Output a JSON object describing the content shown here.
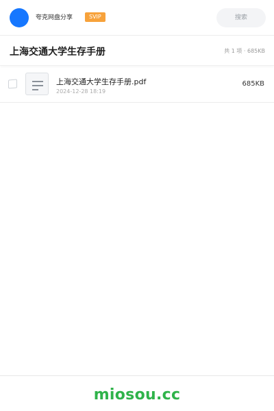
{
  "header": {
    "app_name": "夸克网盘分享",
    "badge": "SVIP",
    "search_label": "搜索"
  },
  "share": {
    "title": "上海交通大学生存手册",
    "summary": "共 1 项 · 685KB"
  },
  "files": [
    {
      "name": "上海交通大学生存手册.pdf",
      "date": "2024-12-28 18:19",
      "size": "685KB",
      "icon": "document-icon"
    }
  ],
  "footer": {
    "brand": "miosou.cc"
  },
  "colors": {
    "accent": "#1677ff",
    "badge": "#f7a23b",
    "brand": "#2fb34a"
  }
}
